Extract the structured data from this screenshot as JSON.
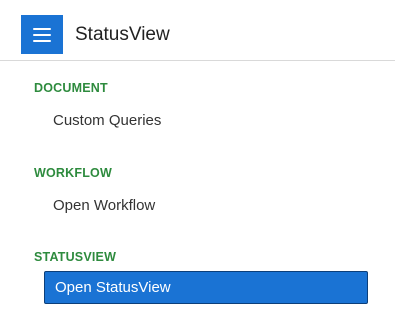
{
  "header": {
    "menu_icon": "hamburger-menu-icon",
    "title": "StatusView",
    "accent_color": "#1a73d4"
  },
  "sidebar": {
    "section_color": "#2e8b3e",
    "sections": [
      {
        "title": "DOCUMENT",
        "items": [
          {
            "label": "Custom Queries",
            "active": false
          }
        ]
      },
      {
        "title": "WORKFLOW",
        "items": [
          {
            "label": "Open Workflow",
            "active": false
          }
        ]
      },
      {
        "title": "STATUSVIEW",
        "items": [
          {
            "label": "Open StatusView",
            "active": true
          }
        ]
      }
    ]
  }
}
